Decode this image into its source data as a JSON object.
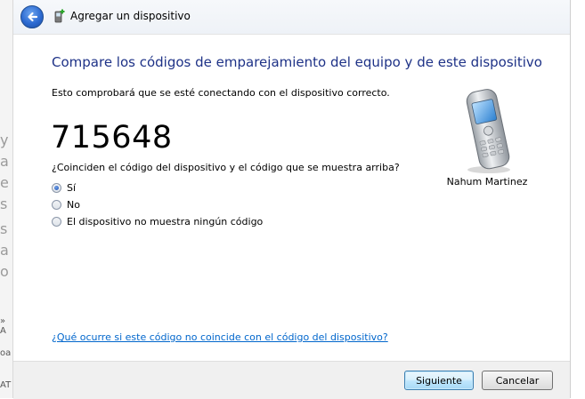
{
  "window": {
    "title": "Agregar un dispositivo"
  },
  "main": {
    "heading": "Compare los códigos de emparejamiento del equipo y de este dispositivo",
    "description": "Esto comprobará que se esté conectando con el dispositivo correcto.",
    "pairing_code": "715648",
    "question": "¿Coinciden el código del dispositivo y el código que se muestra arriba?",
    "options": [
      {
        "label": "Sí",
        "selected": true
      },
      {
        "label": "No",
        "selected": false
      },
      {
        "label": "El dispositivo no muestra ningún código",
        "selected": false
      }
    ],
    "help_link": "¿Qué ocurre si este código no coincide con el código del dispositivo?"
  },
  "device": {
    "name": "Nahum Martinez",
    "icon": "mobile-phone-icon"
  },
  "footer": {
    "next_label": "Siguiente",
    "cancel_label": "Cancelar"
  },
  "colors": {
    "heading": "#1e3287",
    "link": "#0066cc",
    "footer_bg": "#f0f0f0"
  }
}
